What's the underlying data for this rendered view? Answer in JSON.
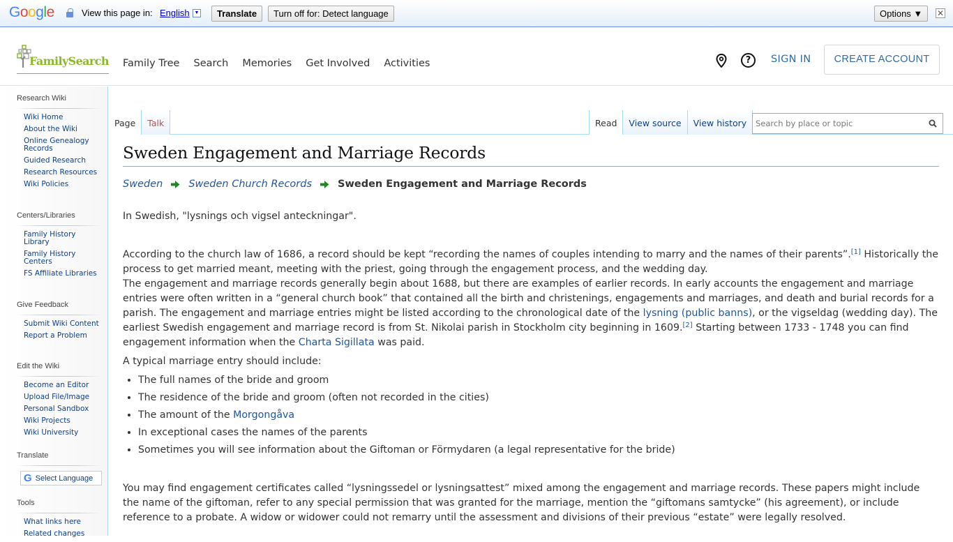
{
  "translate_bar": {
    "logo": [
      "G",
      "o",
      "o",
      "g",
      "l",
      "e"
    ],
    "view_label": "View this page in:",
    "language": "English",
    "translate_button": "Translate",
    "turn_off_button": "Turn off for: Detect language",
    "options_button": "Options ▼",
    "close_icon": "✕"
  },
  "header": {
    "logo_text": "FamilySearch",
    "nav": [
      "Family Tree",
      "Search",
      "Memories",
      "Get Involved",
      "Activities"
    ],
    "help_icon_glyph": "?",
    "sign_in": "SIGN IN",
    "create_account": "CREATE ACCOUNT"
  },
  "sidebar": {
    "sections": [
      {
        "heading": "Research Wiki",
        "items": [
          "Wiki Home",
          "About the Wiki",
          "Online Genealogy Records",
          "Guided Research",
          "Research Resources",
          "Wiki Policies"
        ]
      },
      {
        "heading": "Centers/Libraries",
        "items": [
          "Family History Library",
          "Family History Centers",
          "FS Affiliate Libraries"
        ]
      },
      {
        "heading": "Give Feedback",
        "items": [
          "Submit Wiki Content",
          "Report a Problem"
        ]
      },
      {
        "heading": "Edit the Wiki",
        "items": [
          "Become an Editor",
          "Upload File/Image",
          "Personal Sandbox",
          "Wiki Projects",
          "Wiki University"
        ]
      },
      {
        "heading": "Translate",
        "select_language": "Select Language"
      },
      {
        "heading": "Tools",
        "items": [
          "What links here",
          "Related changes"
        ]
      }
    ]
  },
  "tabs": {
    "left": [
      "Page",
      "Talk"
    ],
    "right": [
      "Read",
      "View source",
      "View history"
    ],
    "search_placeholder": "Search by place or topic"
  },
  "content": {
    "title": "Sweden Engagement and Marriage Records",
    "breadcrumb": [
      "Sweden",
      "Sweden Church Records",
      "Sweden Engagement and Marriage Records"
    ],
    "intro": "In Swedish, \"lysnings och vigsel anteckningar\".",
    "para1": {
      "a": "According to the church law of 1686, a record should be kept “recording the names of couples intending to marry and the names of their parents”.",
      "ref1": "[1]",
      "b": " Historically the process to get married meant, meeting with the priest, going through the engagement process, and the wedding day."
    },
    "para2": {
      "a": "The engagement and marriage records generally begin about 1688, but there are examples of earlier records. In early accounts the engagement and marriage entries were often written in a “general church book” that contained all the birth and christenings, engagements and marriages, and death and burial records for a parish. The engagement and marriage entries might be listed according to the chronological date of the ",
      "link1": "lysning (public banns)",
      "b": ", or the vigseldag (wedding day). The earliest Swedish engagement and marriage record is from St. Nikolai parish in Stockholm city beginning in 1609.",
      "ref2": "[2]",
      "c": " Starting between 1733 - 1748 you can find engagement information when the ",
      "link2": "Charta Sigillata",
      "d": " was paid."
    },
    "list_intro": "A typical marriage entry should include:",
    "list": [
      {
        "text": "The full names of the bride and groom"
      },
      {
        "text": "The residence of the bride and groom (often not recorded in the cities)"
      },
      {
        "text": "The amount of the ",
        "link": "Morgongåva"
      },
      {
        "text": "In exceptional cases the names of the parents"
      },
      {
        "text": "Sometimes you will see information about the Giftoman or Förmydaren (a legal representative for the bride)"
      }
    ],
    "para4": "You may find engagement certificates called “lysningssedel or lysningsattest” mixed among the engagement and marriage records. These papers might include the name of the giftoman, refer to any special permission that was granted for the marriage, mention the “giftomans samtycke” (his agreement), or include reference to a probate. A widow or widower could not remarry until the assessment and divisions of their previous “estate” were legally resolved."
  },
  "colors": {
    "link": "#2155a0",
    "brand_green": "#8cb929",
    "breadcrumb_arrow": "#1e8a1e",
    "accent_blue": "#2e6ba8"
  }
}
